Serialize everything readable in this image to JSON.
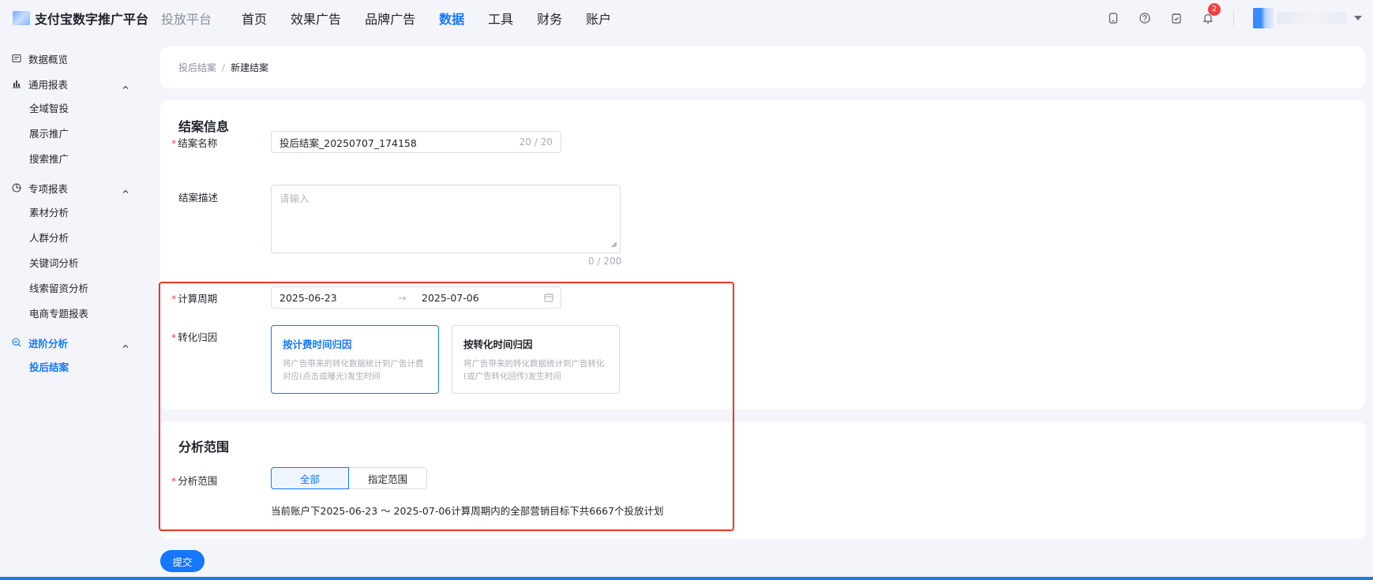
{
  "header": {
    "logo_text": "支付宝数字推广平台",
    "sub_title": "投放平台",
    "nav": [
      {
        "label": "首页",
        "active": false
      },
      {
        "label": "效果广告",
        "active": false
      },
      {
        "label": "品牌广告",
        "active": false
      },
      {
        "label": "数据",
        "active": true
      },
      {
        "label": "工具",
        "active": false
      },
      {
        "label": "财务",
        "active": false
      },
      {
        "label": "账户",
        "active": false
      }
    ],
    "notification_count": "2",
    "icons": [
      "mobile-icon",
      "help-icon",
      "task-check-icon",
      "bell-icon"
    ]
  },
  "sidebar": {
    "overview": "数据概览",
    "general_reports": {
      "label": "通用报表",
      "items": [
        "全域智投",
        "展示推广",
        "搜索推广"
      ]
    },
    "special_reports": {
      "label": "专项报表",
      "items": [
        "素材分析",
        "人群分析",
        "关键词分析",
        "线索留资分析",
        "电商专题报表"
      ]
    },
    "advanced": {
      "label": "进阶分析",
      "items": [
        "投后结案"
      ]
    }
  },
  "breadcrumb": {
    "parent": "投后结案",
    "separator": "/",
    "current": "新建结案"
  },
  "form": {
    "section_title": "结案信息",
    "name": {
      "label": "结案名称",
      "value": "投后结案_20250707_174158",
      "count": "20 / 20"
    },
    "description": {
      "label": "结案描述",
      "placeholder": "请输入",
      "count": "0 / 200"
    },
    "period": {
      "label": "计算周期",
      "start": "2025-06-23",
      "arrow": "→",
      "end": "2025-07-06"
    },
    "attribution": {
      "label": "转化归因",
      "options": [
        {
          "title": "按计费时间归因",
          "desc": "将广告带来的转化数据统计到广告计费对应(点击或曝光)发生时间",
          "selected": true
        },
        {
          "title": "按转化时间归因",
          "desc": "将广告带来的转化数据统计到广告转化(或广告转化回传)发生时间",
          "selected": false
        }
      ]
    }
  },
  "scope": {
    "section_title": "分析范围",
    "label": "分析范围",
    "options": [
      "全部",
      "指定范围"
    ],
    "selected": "全部",
    "note": "当前账户下2025-06-23 ～ 2025-07-06计算周期内的全部营销目标下共6667个投放计划"
  },
  "submit_label": "提交",
  "colors": {
    "accent": "#1677ff",
    "required": "#f53f3f",
    "highlight_border": "#e0392b"
  }
}
